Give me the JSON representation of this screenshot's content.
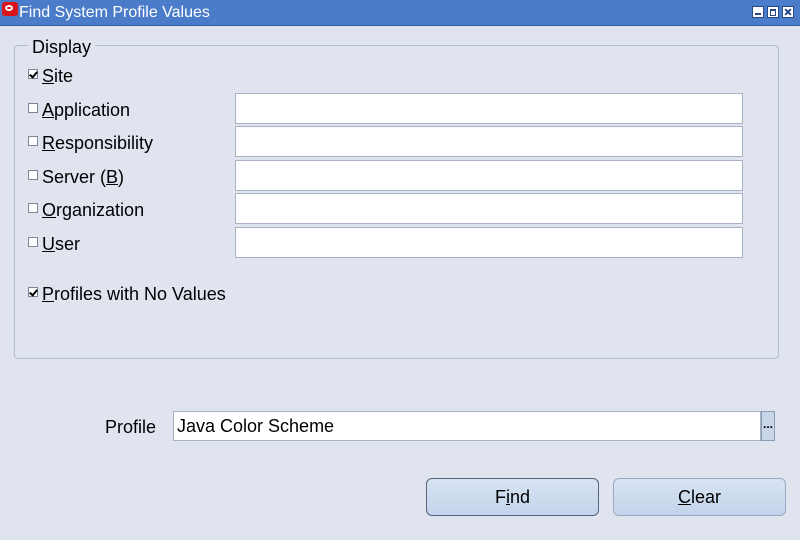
{
  "window": {
    "title": "Find System Profile Values"
  },
  "display": {
    "label": "Display",
    "options": [
      {
        "pre": "",
        "key": "S",
        "post": "ite",
        "checked": true,
        "has_field": false,
        "field_value": ""
      },
      {
        "pre": "",
        "key": "A",
        "post": "pplication",
        "checked": false,
        "has_field": true,
        "field_value": ""
      },
      {
        "pre": "",
        "key": "R",
        "post": "esponsibility",
        "checked": false,
        "has_field": true,
        "field_value": ""
      },
      {
        "pre": "Server (",
        "key": "B",
        "post": ")",
        "checked": false,
        "has_field": true,
        "field_value": ""
      },
      {
        "pre": "",
        "key": "O",
        "post": "rganization",
        "checked": false,
        "has_field": true,
        "field_value": ""
      },
      {
        "pre": "",
        "key": "U",
        "post": "ser",
        "checked": false,
        "has_field": true,
        "field_value": ""
      }
    ],
    "no_values": {
      "pre": "",
      "key": "P",
      "post": "rofiles with No Values",
      "checked": true
    }
  },
  "profile": {
    "label": "Profile",
    "value": "Java Color Scheme",
    "lov_label": "..."
  },
  "buttons": {
    "find": {
      "pre": "F",
      "key": "i",
      "post": "nd"
    },
    "clear": {
      "pre": "",
      "key": "C",
      "post": "lear"
    }
  },
  "colors": {
    "titlebar": "#4a7cc9",
    "background": "#dfe4ef",
    "button": "#c8d8ee"
  }
}
